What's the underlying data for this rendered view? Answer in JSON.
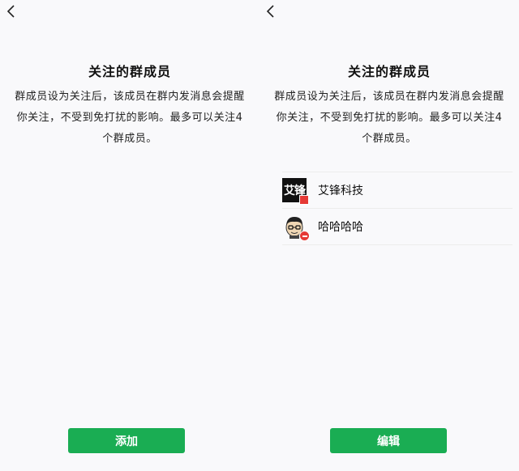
{
  "screens": [
    {
      "back_icon": "chevron-left-icon",
      "title": "关注的群成员",
      "description": "群成员设为关注后，该成员在群内发消息会提醒你关注，不受到免打扰的影响。最多可以关注4个群成员。",
      "members": [],
      "button_label": "添加"
    },
    {
      "back_icon": "chevron-left-icon",
      "title": "关注的群成员",
      "description": "群成员设为关注后，该成员在群内发消息会提醒你关注，不受到免打扰的影响。最多可以关注4个群成员。",
      "members": [
        {
          "name": "艾锋科技",
          "avatar_text": "艾锋",
          "avatar_badge": "red-tag"
        },
        {
          "name": "哈哈哈哈",
          "avatar_text": "",
          "avatar_badge": "remove-icon"
        }
      ],
      "button_label": "编辑"
    }
  ],
  "colors": {
    "accent_green": "#1aad53",
    "badge_red": "#e53935",
    "background": "#f9f9fb"
  }
}
